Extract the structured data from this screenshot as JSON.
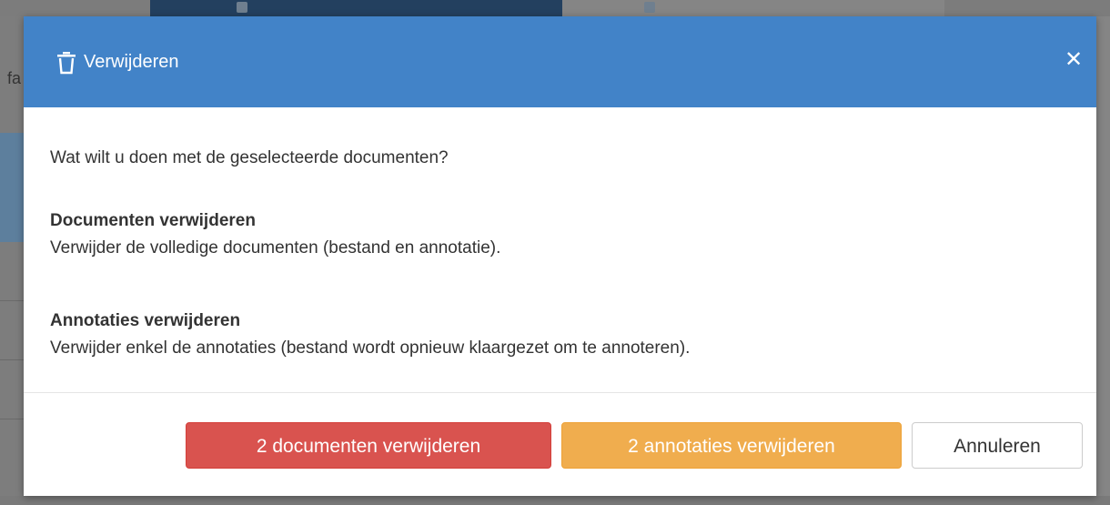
{
  "background": {
    "left_letters": "fa"
  },
  "modal": {
    "header": {
      "icon": "trash-icon",
      "title": "Verwijderen",
      "close_icon": "close-icon",
      "close_glyph": "✕"
    },
    "body": {
      "question": "Wat wilt u doen met de geselecteerde documenten?",
      "options": [
        {
          "title": "Documenten verwijderen",
          "description": "Verwijder de volledige documenten (bestand en annotatie)."
        },
        {
          "title": "Annotaties verwijderen",
          "description": "Verwijder enkel de annotaties (bestand wordt opnieuw klaargezet om te annoteren)."
        }
      ]
    },
    "footer": {
      "delete_documents_label": "2 documenten verwijderen",
      "delete_annotations_label": "2 annotaties verwijderen",
      "cancel_label": "Annuleren"
    }
  },
  "colors": {
    "header": "#4283c8",
    "danger": "#d9534f",
    "warning": "#f0ad4e",
    "overlay": "#7f7f7f"
  }
}
